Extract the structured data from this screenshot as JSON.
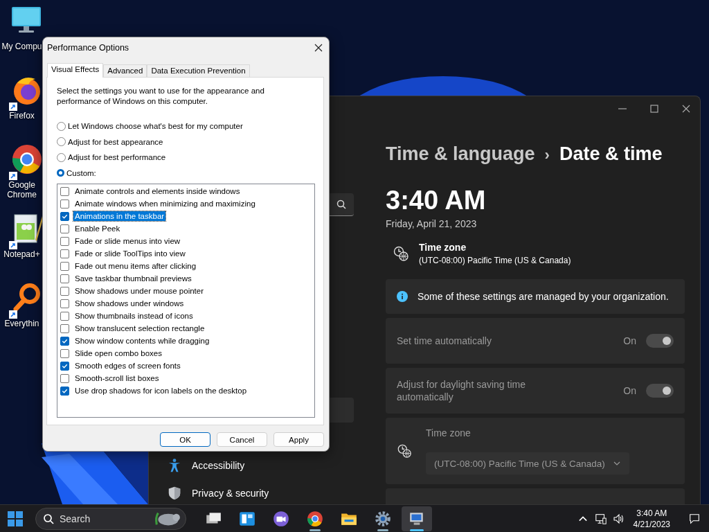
{
  "desktop_icons": [
    {
      "label": "My Compu",
      "kind": "computer",
      "shortcut": false
    },
    {
      "label": "Firefox",
      "kind": "firefox",
      "shortcut": true
    },
    {
      "label": "Google Chrome",
      "kind": "chrome",
      "shortcut": true
    },
    {
      "label": "Notepad+",
      "kind": "notepad",
      "shortcut": true
    },
    {
      "label": "Everythin",
      "kind": "everything",
      "shortcut": true
    }
  ],
  "settings_window": {
    "nav_items": [
      {
        "label": "Accessibility",
        "kind": "accessibility"
      },
      {
        "label": "Privacy & security",
        "kind": "shield"
      }
    ],
    "breadcrumb_parent": "Time & language",
    "breadcrumb_separator": "›",
    "breadcrumb_current": "Date & time",
    "time": "3:40 AM",
    "date": "Friday, April 21, 2023",
    "time_zone_title": "Time zone",
    "time_zone_value": "(UTC-08:00) Pacific Time (US & Canada)",
    "notice": "Some of these settings are managed by your organization.",
    "toggles": [
      {
        "label": "Set time automatically",
        "state": "On",
        "on": true,
        "disabled": true
      },
      {
        "label": "Adjust for daylight saving time automatically",
        "state": "On",
        "on": true,
        "disabled": true
      }
    ],
    "time_zone_select": {
      "label": "Time zone",
      "value": "(UTC-08:00) Pacific Time (US & Canada)",
      "disabled": true
    }
  },
  "dialog": {
    "title": "Performance Options",
    "tabs": [
      {
        "label": "Visual Effects",
        "selected": true
      },
      {
        "label": "Advanced",
        "selected": false
      },
      {
        "label": "Data Execution Prevention",
        "selected": false
      }
    ],
    "description": "Select the settings you want to use for the appearance and performance of Windows on this computer.",
    "radios": [
      {
        "label": "Let Windows choose what's best for my computer",
        "selected": false
      },
      {
        "label": "Adjust for best appearance",
        "selected": false
      },
      {
        "label": "Adjust for best performance",
        "selected": false
      },
      {
        "label": "Custom:",
        "selected": true
      }
    ],
    "effects": [
      {
        "label": "Animate controls and elements inside windows",
        "checked": false,
        "selected": false
      },
      {
        "label": "Animate windows when minimizing and maximizing",
        "checked": false,
        "selected": false
      },
      {
        "label": "Animations in the taskbar",
        "checked": true,
        "selected": true
      },
      {
        "label": "Enable Peek",
        "checked": false,
        "selected": false
      },
      {
        "label": "Fade or slide menus into view",
        "checked": false,
        "selected": false
      },
      {
        "label": "Fade or slide ToolTips into view",
        "checked": false,
        "selected": false
      },
      {
        "label": "Fade out menu items after clicking",
        "checked": false,
        "selected": false
      },
      {
        "label": "Save taskbar thumbnail previews",
        "checked": false,
        "selected": false
      },
      {
        "label": "Show shadows under mouse pointer",
        "checked": false,
        "selected": false
      },
      {
        "label": "Show shadows under windows",
        "checked": false,
        "selected": false
      },
      {
        "label": "Show thumbnails instead of icons",
        "checked": false,
        "selected": false
      },
      {
        "label": "Show translucent selection rectangle",
        "checked": false,
        "selected": false
      },
      {
        "label": "Show window contents while dragging",
        "checked": true,
        "selected": false
      },
      {
        "label": "Slide open combo boxes",
        "checked": false,
        "selected": false
      },
      {
        "label": "Smooth edges of screen fonts",
        "checked": true,
        "selected": false
      },
      {
        "label": "Smooth-scroll list boxes",
        "checked": false,
        "selected": false
      },
      {
        "label": "Use drop shadows for icon labels on the desktop",
        "checked": true,
        "selected": false
      }
    ],
    "buttons": [
      {
        "label": "OK",
        "default": true
      },
      {
        "label": "Cancel",
        "default": false
      },
      {
        "label": "Apply",
        "default": false
      }
    ]
  },
  "taskbar": {
    "search": {
      "placeholder": "Search"
    },
    "apps": [
      {
        "kind": "task-view",
        "running": false,
        "active": false
      },
      {
        "kind": "widgets",
        "running": false,
        "active": false
      },
      {
        "kind": "chat",
        "running": false,
        "active": false
      },
      {
        "kind": "chrome",
        "running": true,
        "active": false
      },
      {
        "kind": "folder",
        "running": false,
        "active": false
      },
      {
        "kind": "gear",
        "running": true,
        "active": false
      },
      {
        "kind": "monitor",
        "running": true,
        "active": true
      }
    ],
    "clock": {
      "time": "3:40 AM",
      "date": "4/21/2023"
    }
  }
}
